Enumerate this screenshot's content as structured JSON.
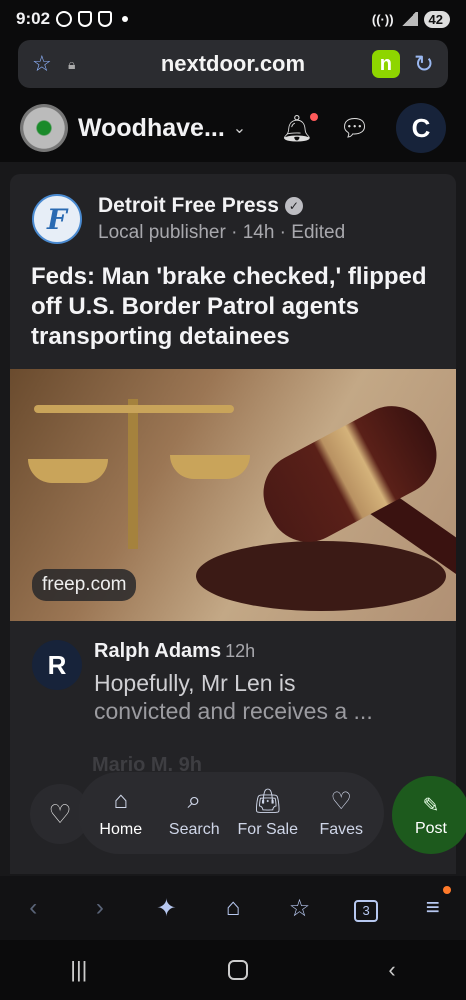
{
  "status_bar": {
    "time": "9:02",
    "battery": "42"
  },
  "browser": {
    "url": "nextdoor.com"
  },
  "header": {
    "neighborhood": "Woodhave...",
    "user_initial": "C"
  },
  "post": {
    "publisher": "Detroit Free Press",
    "meta": "Local publisher · 14h · Edited",
    "headline": "Feds: Man 'brake checked,' flipped off U.S. Border Patrol agents transporting detainees",
    "image_source": "freep.com"
  },
  "comment": {
    "initial": "R",
    "author": "Ralph Adams",
    "time": "12h",
    "text_line1": "Hopefully, Mr Len is",
    "text_line2": "convicted and receives a ...",
    "next_author_faded": "Mario M. 9h"
  },
  "bottom_nav": {
    "items": [
      {
        "label": "Home",
        "icon": "home-icon"
      },
      {
        "label": "Search",
        "icon": "search-icon"
      },
      {
        "label": "For Sale",
        "icon": "bag-icon"
      },
      {
        "label": "Faves",
        "icon": "heart-icon"
      }
    ],
    "post_label": "Post"
  },
  "browser_nav": {
    "tabs_count": "3"
  }
}
